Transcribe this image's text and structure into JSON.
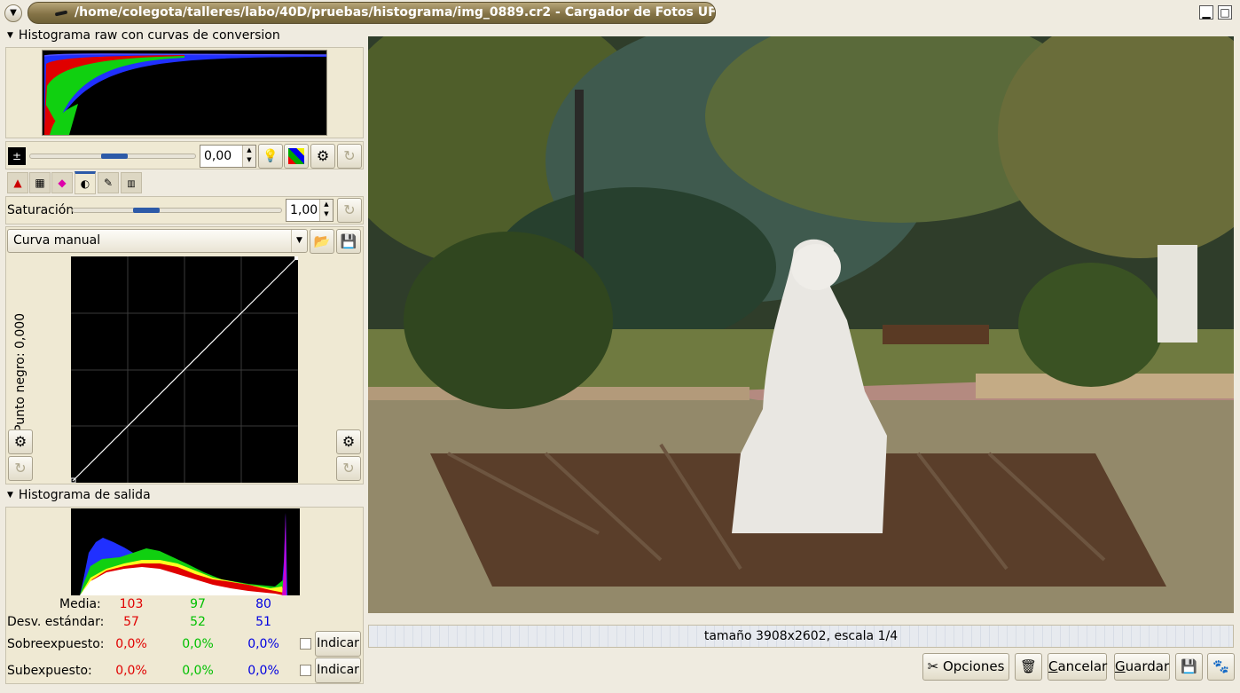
{
  "window": {
    "title": "/home/colegota/talleres/labo/40D/pruebas/histograma/img_0889.cr2 - Cargador de Fotos UFRaw"
  },
  "raw_histogram": {
    "title": "Histograma raw con curvas de conversion",
    "exposure_value": "0,00",
    "exposure_slider_fraction": 0.5
  },
  "tabs": [
    {
      "icon": "wb-icon"
    },
    {
      "icon": "grayscale-icon"
    },
    {
      "icon": "color-management-icon"
    },
    {
      "icon": "correction-icon"
    },
    {
      "icon": "lightness-icon"
    },
    {
      "icon": "exif-icon"
    }
  ],
  "saturation": {
    "label": "Saturación",
    "value": "1,00",
    "slider_fraction": 0.33
  },
  "curve": {
    "preset": "Curva manual",
    "black_point_label": "Punto negro: 0,000"
  },
  "output_histogram": {
    "title": "Histograma de salida",
    "stats": {
      "media_label": "Media:",
      "media": {
        "r": "103",
        "g": "97",
        "b": "80"
      },
      "std_label": "Desv. estándar:",
      "std": {
        "r": "57",
        "g": "52",
        "b": "51"
      },
      "over_label": "Sobreexpuesto:",
      "over": {
        "r": "0,0%",
        "g": "0,0%",
        "b": "0,0%"
      },
      "under_label": "Subexpuesto:",
      "under": {
        "r": "0,0%",
        "g": "0,0%",
        "b": "0,0%"
      },
      "indicate_label": "Indicar"
    }
  },
  "preview": {
    "status": "tamaño 3908x2602, escala 1/4"
  },
  "buttons": {
    "options": "Opciones",
    "cancel_prefix": "C",
    "cancel_rest": "ancelar",
    "save_prefix": "G",
    "save_rest": "uardar"
  },
  "colors": {
    "accent": "#2d5aa8",
    "red": "#e00000",
    "green": "#00c000",
    "blue": "#0000e0",
    "title_bar": "#857447"
  }
}
